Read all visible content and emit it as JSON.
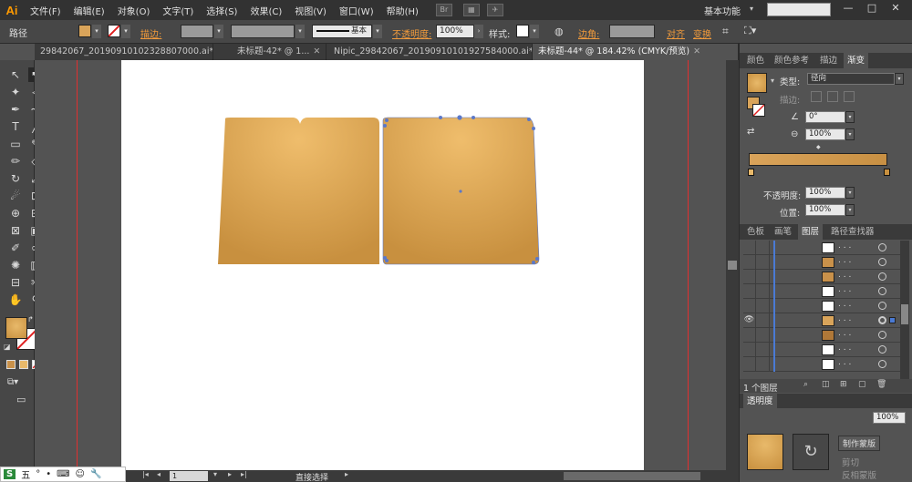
{
  "app": {
    "logo": "Ai"
  },
  "menu": [
    "文件(F)",
    "编辑(E)",
    "对象(O)",
    "文字(T)",
    "选择(S)",
    "效果(C)",
    "视图(V)",
    "窗口(W)",
    "帮助(H)"
  ],
  "menubar_icons": {
    "bridge": "Br"
  },
  "workspace": "基本功能",
  "window_controls": {
    "minimize": "—",
    "maximize": "□",
    "close": "✕"
  },
  "control": {
    "object_type": "路径",
    "stroke_label": "描边:",
    "stroke_style": "基本",
    "opacity_label": "不透明度:",
    "opacity_value": "100%",
    "style_label": "样式:",
    "corner_label": "边角:",
    "align_label": "对齐",
    "transform_label": "变换",
    "fill_color": "#d9a45a",
    "stroke_color": "#ffffff"
  },
  "tabs": [
    {
      "label": "29842067_20190910102328807000.ai*",
      "active": false
    },
    {
      "label": "未标题-42* @ 1...",
      "active": false
    },
    {
      "label": "Nipic_29842067_20190910101927584000.ai*",
      "active": false
    },
    {
      "label": "未标题-44* @ 184.42% (CMYK/预览)",
      "active": true
    }
  ],
  "tab_close_glyph": "✕",
  "tools": [
    "selection-tool",
    "direct-selection-tool",
    "magic-wand-tool",
    "lasso-tool",
    "pen-tool",
    "curvature-tool",
    "type-tool",
    "line-tool",
    "rectangle-tool",
    "paintbrush-tool",
    "pencil-tool",
    "eraser-tool",
    "rotate-tool",
    "scale-tool",
    "warp-tool",
    "free-transform-tool",
    "shape-builder-tool",
    "perspective-tool",
    "mesh-tool",
    "gradient-tool",
    "eyedropper-tool",
    "blend-tool",
    "symbol-tool",
    "column-graph-tool",
    "artboard-tool",
    "slice-tool",
    "hand-tool",
    "zoom-tool"
  ],
  "tool_glyphs": [
    "↖",
    "⬉",
    "✦",
    "⟡",
    "✒",
    "↝",
    "T",
    "╱",
    "▭",
    "✎",
    "✏",
    "◇",
    "↻",
    "⤢",
    "☄",
    "⊡",
    "⊕",
    "⊞",
    "⊠",
    "▣",
    "✐",
    "∞",
    "✺",
    "▥",
    "⊟",
    "✂",
    "✋",
    "⚲"
  ],
  "panels": {
    "color_tabs": [
      "颜色",
      "颜色参考",
      "描边",
      "渐变"
    ],
    "gradient": {
      "type_label": "类型:",
      "type_value": "径向",
      "stroke_label": "描边:",
      "angle_value": "0°",
      "aspect_value": "100%",
      "opacity_label": "不透明度:",
      "opacity_value": "100%",
      "location_label": "位置:",
      "location_value": "100%",
      "start_color": "#e8b96a",
      "end_color": "#c8903f"
    },
    "layer_tabs": [
      "色板",
      "画笔",
      "图层",
      "路径查找器"
    ],
    "layers": [
      {
        "dots": ". . .",
        "thumb": "#ffffff",
        "visible": false
      },
      {
        "dots": ". . .",
        "thumb": "#c9914a",
        "visible": false
      },
      {
        "dots": ". . .",
        "thumb": "#c9914a",
        "visible": false
      },
      {
        "dots": ". . .",
        "thumb": "#ffffff",
        "visible": false
      },
      {
        "dots": ". . .",
        "thumb": "#ffffff",
        "visible": false
      },
      {
        "dots": ". . .",
        "thumb": "#d9a45a",
        "visible": true
      },
      {
        "dots": ". . .",
        "thumb": "#b07838",
        "visible": false
      },
      {
        "dots": ". . .",
        "thumb": "#ffffff",
        "visible": false
      },
      {
        "dots": ". . .",
        "thumb": "#ffffff",
        "visible": false
      }
    ],
    "visibility_glyph": "👁",
    "layers_count": "1 个图层",
    "transparency_label": "透明度",
    "transp_opacity": "100%",
    "make_mask": "制作蒙版",
    "clip_label": "剪切",
    "invert_mask": "反相蒙版"
  },
  "status": {
    "zoom_value": "1",
    "tool_name": "直接选择"
  },
  "taskbar": [
    "S",
    "五",
    "°",
    "•",
    "⌨",
    "☺"
  ]
}
